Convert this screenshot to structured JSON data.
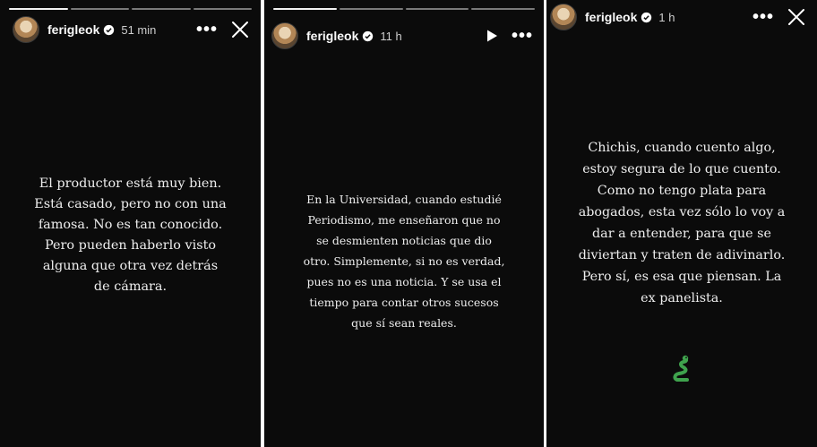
{
  "stories": [
    {
      "username": "ferigleok",
      "time": "51 min",
      "text": "El productor está muy bien.\nEstá casado, pero no con una\nfamosa. No es tan conocido.\nPero pueden haberlo visto\nalguna que otra vez detrás\nde cámara.",
      "progress": {
        "segments": 4,
        "active": 1
      },
      "icons": [
        "more-icon",
        "close-icon"
      ]
    },
    {
      "username": "ferigleok",
      "time": "11 h",
      "text": "En la Universidad, cuando estudié\nPeriodismo, me enseñaron que no\nse desmienten noticias que dio\notro. Simplemente, si no es verdad,\npues no es una noticia. Y se usa el\ntiempo para contar otros sucesos\nque sí sean reales.",
      "progress": {
        "segments": 4,
        "active": 1
      },
      "icons": [
        "play-icon",
        "more-icon"
      ]
    },
    {
      "username": "ferigleok",
      "time": "1 h",
      "text": "Chichis, cuando cuento algo,\nestoy segura de lo que cuento.\nComo no tengo plata para\nabogados, esta vez sólo lo voy a\ndar a entender, para que se\ndiviertan y traten de adivinarlo.\nPero sí, es esa que piensan. La\nex panelista.",
      "sticker": "snake-emoji",
      "icons": [
        "more-icon",
        "close-icon"
      ]
    }
  ],
  "colors": {
    "background": "#0b0b0b",
    "text": "#eeeeee",
    "snake": "#3fa34d"
  }
}
